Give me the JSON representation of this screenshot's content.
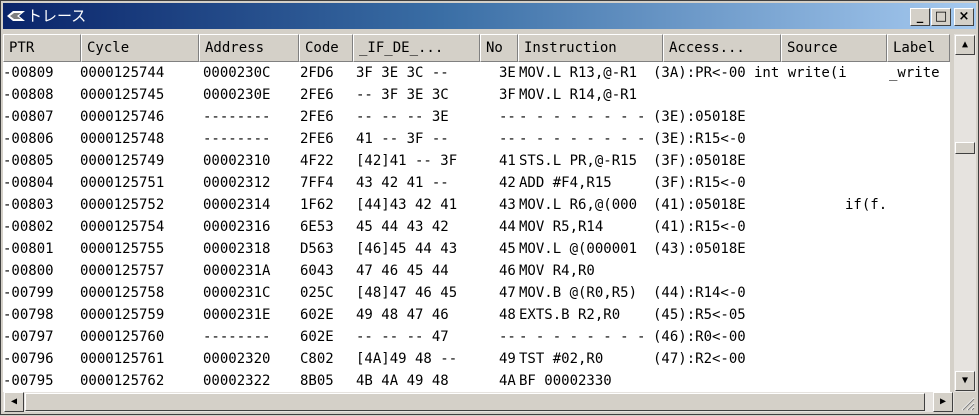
{
  "window": {
    "title": "トレース",
    "minimize_glyph": "_",
    "maximize_glyph": "□",
    "close_glyph": "×"
  },
  "columns": [
    "PTR",
    "Cycle",
    "Address",
    "Code",
    "_IF_DE_...",
    "No",
    "Instruction",
    "Access...",
    "Source",
    "Label"
  ],
  "rows": [
    {
      "ptr": "-00809",
      "cycle": "0000125744",
      "address": "0000230C",
      "code": "2FD6",
      "ifde": "3F 3E 3C --",
      "no": "3E",
      "instruction": "MOV.L R13,@-R1",
      "access": "(3A):PR<-00",
      "source": "int write(i",
      "label": "_write"
    },
    {
      "ptr": "-00808",
      "cycle": "0000125745",
      "address": "0000230E",
      "code": "2FE6",
      "ifde": "-- 3F 3E 3C",
      "no": "3F",
      "instruction": "MOV.L R14,@-R1",
      "access": "",
      "source": "",
      "label": ""
    },
    {
      "ptr": "-00807",
      "cycle": "0000125746",
      "address": "--------",
      "code": "2FE6",
      "ifde": "-- -- -- 3E",
      "no": "--",
      "instruction": "- - - - - - - -",
      "access": "(3E):05018E",
      "source": "",
      "label": ""
    },
    {
      "ptr": "-00806",
      "cycle": "0000125748",
      "address": "--------",
      "code": "2FE6",
      "ifde": "41 -- 3F --",
      "no": "--",
      "instruction": "- - - - - - - -",
      "access": "(3E):R15<-0",
      "source": "",
      "label": ""
    },
    {
      "ptr": "-00805",
      "cycle": "0000125749",
      "address": "00002310",
      "code": "4F22",
      "ifde": "[42]41 -- 3F",
      "no": "41",
      "instruction": "STS.L PR,@-R15",
      "access": "(3F):05018E",
      "source": "",
      "label": ""
    },
    {
      "ptr": "-00804",
      "cycle": "0000125751",
      "address": "00002312",
      "code": "7FF4",
      "ifde": "43 42 41 --",
      "no": "42",
      "instruction": "ADD #F4,R15",
      "access": "(3F):R15<-0",
      "source": "",
      "label": ""
    },
    {
      "ptr": "-00803",
      "cycle": "0000125752",
      "address": "00002314",
      "code": "1F62",
      "ifde": "[44]43 42 41",
      "no": "43",
      "instruction": "MOV.L R6,@(000",
      "access": "(41):05018E",
      "source": "if(f.",
      "label": ""
    },
    {
      "ptr": "-00802",
      "cycle": "0000125754",
      "address": "00002316",
      "code": "6E53",
      "ifde": "45 44 43 42",
      "no": "44",
      "instruction": "MOV R5,R14",
      "access": "(41):R15<-0",
      "source": "",
      "label": ""
    },
    {
      "ptr": "-00801",
      "cycle": "0000125755",
      "address": "00002318",
      "code": "D563",
      "ifde": "[46]45 44 43",
      "no": "45",
      "instruction": "MOV.L @(000001",
      "access": "(43):05018E",
      "source": "",
      "label": ""
    },
    {
      "ptr": "-00800",
      "cycle": "0000125757",
      "address": "0000231A",
      "code": "6043",
      "ifde": "47 46 45 44",
      "no": "46",
      "instruction": "MOV R4,R0",
      "access": "",
      "source": "",
      "label": ""
    },
    {
      "ptr": "-00799",
      "cycle": "0000125758",
      "address": "0000231C",
      "code": "025C",
      "ifde": "[48]47 46 45",
      "no": "47",
      "instruction": "MOV.B @(R0,R5)",
      "access": "(44):R14<-0",
      "source": "",
      "label": ""
    },
    {
      "ptr": "-00798",
      "cycle": "0000125759",
      "address": "0000231E",
      "code": "602E",
      "ifde": "49 48 47 46",
      "no": "48",
      "instruction": "EXTS.B R2,R0",
      "access": "(45):R5<-05",
      "source": "",
      "label": ""
    },
    {
      "ptr": "-00797",
      "cycle": "0000125760",
      "address": "--------",
      "code": "602E",
      "ifde": "-- -- -- 47",
      "no": "--",
      "instruction": "- - - - - - - -",
      "access": "(46):R0<-00",
      "source": "",
      "label": ""
    },
    {
      "ptr": "-00796",
      "cycle": "0000125761",
      "address": "00002320",
      "code": "C802",
      "ifde": "[4A]49 48 --",
      "no": "49",
      "instruction": "TST #02,R0",
      "access": "(47):R2<-00",
      "source": "",
      "label": ""
    },
    {
      "ptr": "-00795",
      "cycle": "0000125762",
      "address": "00002322",
      "code": "8B05",
      "ifde": "4B 4A 49 48",
      "no": "4A",
      "instruction": "BF 00002330",
      "access": "",
      "source": "",
      "label": ""
    }
  ]
}
